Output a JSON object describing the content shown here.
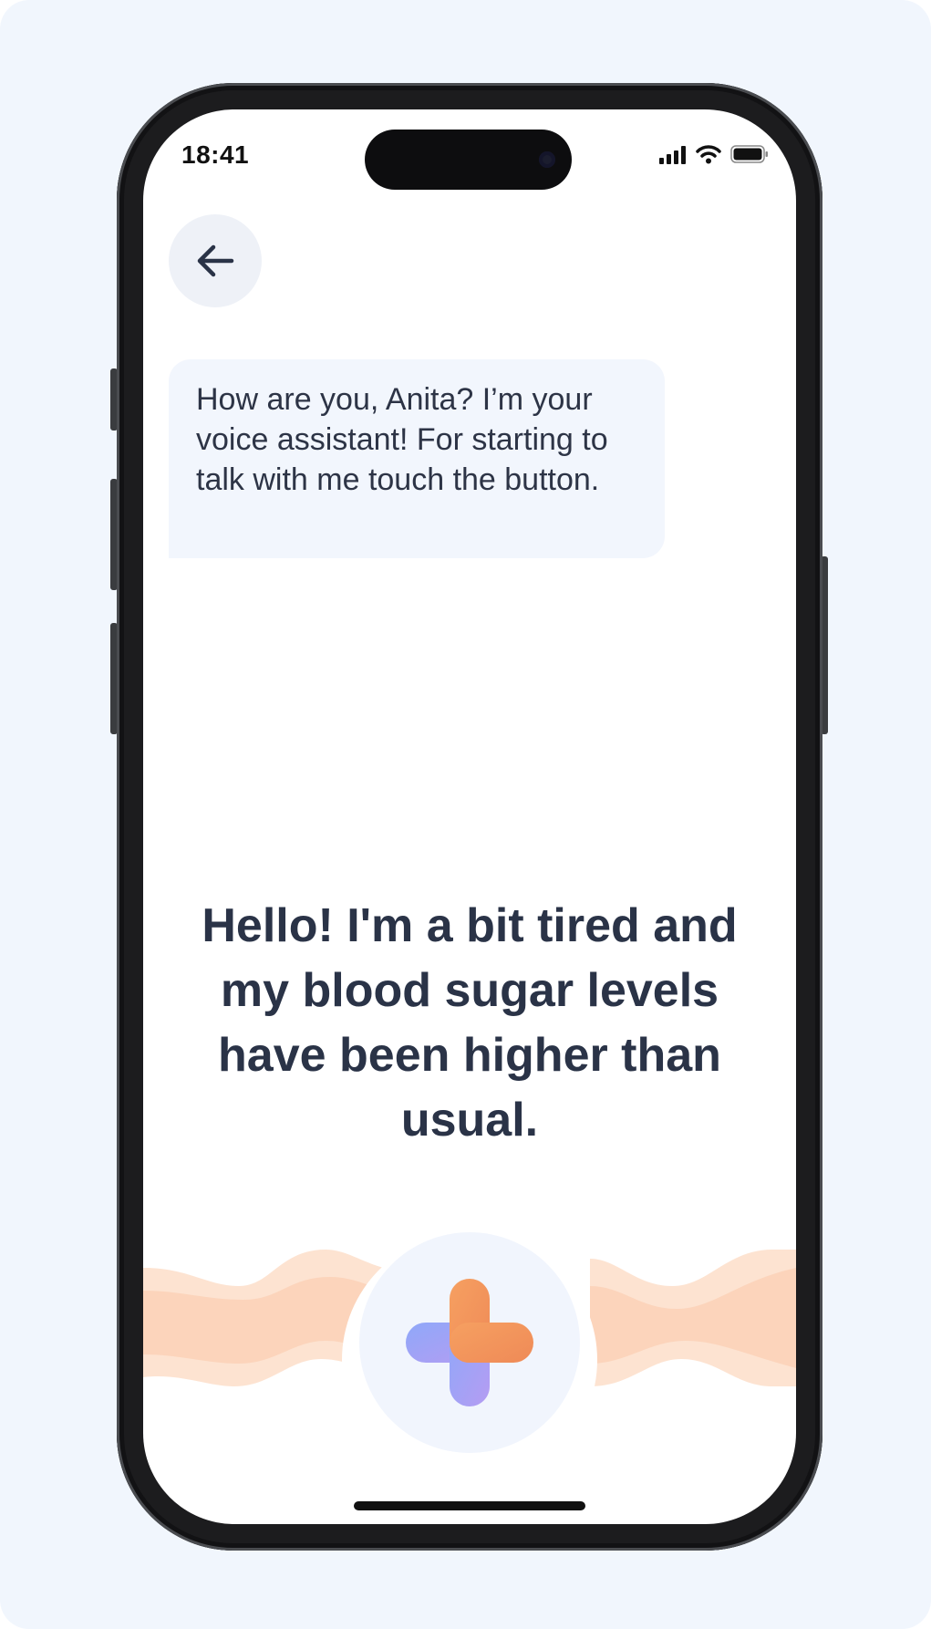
{
  "status_bar": {
    "time": "18:41"
  },
  "navigation": {
    "back_icon": "arrow-left-icon"
  },
  "assistant_message": {
    "text": "How are you, Anita? I’m your voice assistant! For starting to talk with me touch the button."
  },
  "user_transcript": {
    "text": "Hello! I'm a bit tired and my blood sugar levels have been higher than usual."
  },
  "voice_button": {
    "icon": "plus-logo-icon"
  },
  "colors": {
    "background": "#f1f6fd",
    "text_dark": "#2a3347",
    "bubble": "#f2f6fd",
    "wave": "#fcd9c2",
    "accent_orange": "#f3955a",
    "accent_purple": "#a5a3f5"
  }
}
